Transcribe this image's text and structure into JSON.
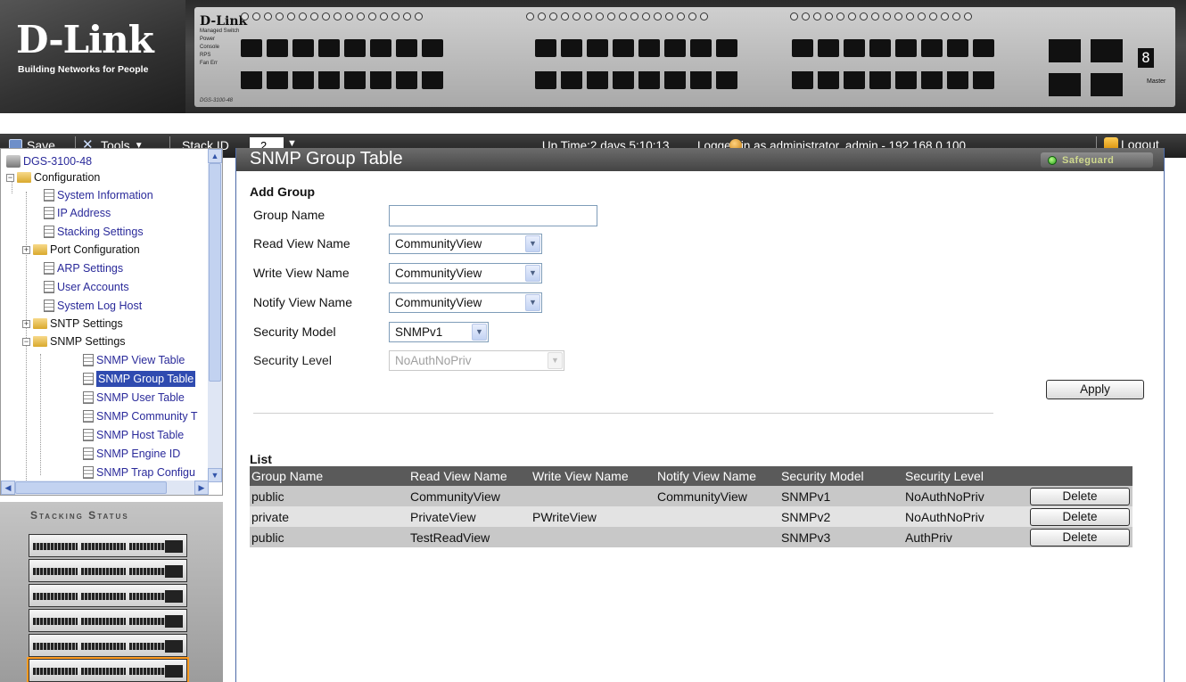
{
  "banner": {
    "logo": "D-Link",
    "tagline": "Building Networks for People",
    "switch_brand": "D-Link",
    "switch_subtitle": "Managed Switch",
    "leds": [
      "Power",
      "Console",
      "RPS",
      "Fan Err"
    ],
    "model": "DGS-3100-48",
    "stack_digit": "8",
    "master_label": "Master"
  },
  "toolbar": {
    "save_label": "Save",
    "tools_label": "Tools",
    "stack_id_label": "Stack ID",
    "stack_id_value": "2",
    "status_text": "Up Time:2 days 5:10:13",
    "login_text": "Logged in as administrator, admin - 192.168.0.100",
    "logout_label": "Logout"
  },
  "tree": {
    "root": "DGS-3100-48",
    "configuration": "Configuration",
    "items": [
      {
        "label": "System Information"
      },
      {
        "label": "IP Address"
      },
      {
        "label": "Stacking Settings"
      },
      {
        "label": "Port Configuration"
      },
      {
        "label": "ARP Settings"
      },
      {
        "label": "User Accounts"
      },
      {
        "label": "System Log Host"
      },
      {
        "label": "SNTP Settings"
      },
      {
        "label": "SNMP Settings"
      }
    ],
    "snmp_items": [
      {
        "label": "SNMP View Table"
      },
      {
        "label": "SNMP Group Table"
      },
      {
        "label": "SNMP User Table"
      },
      {
        "label": "SNMP Community T"
      },
      {
        "label": "SNMP Host Table"
      },
      {
        "label": "SNMP Engine ID"
      },
      {
        "label": "SNMP Trap Configu"
      }
    ]
  },
  "stacking": {
    "title": "Stacking Status",
    "unit_count": 6,
    "active_unit": 6
  },
  "main": {
    "title": "SNMP Group Table",
    "safeguard_label": "Safeguard",
    "add_group": {
      "heading": "Add Group",
      "group_name_label": "Group Name",
      "group_name_value": "",
      "read_view_label": "Read View Name",
      "read_view_value": "CommunityView",
      "write_view_label": "Write View Name",
      "write_view_value": "CommunityView",
      "notify_view_label": "Notify View Name",
      "notify_view_value": "CommunityView",
      "security_model_label": "Security Model",
      "security_model_value": "SNMPv1",
      "security_level_label": "Security Level",
      "security_level_value": "NoAuthNoPriv",
      "apply_label": "Apply"
    },
    "list": {
      "heading": "List",
      "columns": [
        "Group Name",
        "Read View Name",
        "Write View Name",
        "Notify View Name",
        "Security Model",
        "Security Level"
      ],
      "rows": [
        {
          "group": "public",
          "read": "CommunityView",
          "write": "",
          "notify": "CommunityView",
          "model": "SNMPv1",
          "level": "NoAuthNoPriv"
        },
        {
          "group": "private",
          "read": "PrivateView",
          "write": "PWriteView",
          "notify": "",
          "model": "SNMPv2",
          "level": "NoAuthNoPriv"
        },
        {
          "group": "public",
          "read": "TestReadView",
          "write": "",
          "notify": "",
          "model": "SNMPv3",
          "level": "AuthPriv"
        }
      ],
      "delete_label": "Delete"
    }
  }
}
